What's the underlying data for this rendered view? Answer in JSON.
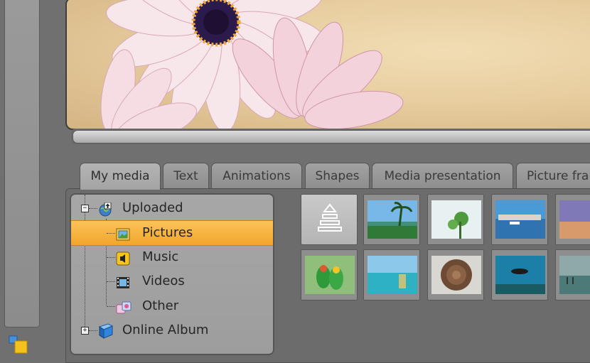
{
  "tabs": [
    {
      "label": "My media",
      "active": true
    },
    {
      "label": "Text",
      "active": false
    },
    {
      "label": "Animations",
      "active": false
    },
    {
      "label": "Shapes",
      "active": false
    },
    {
      "label": "Media presentation",
      "active": false
    },
    {
      "label": "Picture fra",
      "active": false
    }
  ],
  "tree": {
    "uploaded": {
      "label": "Uploaded",
      "expander": "−",
      "icon": "upload-globe-icon"
    },
    "pictures": {
      "label": "Pictures",
      "icon": "pictures-icon",
      "selected": true
    },
    "music": {
      "label": "Music",
      "icon": "music-icon"
    },
    "videos": {
      "label": "Videos",
      "icon": "film-icon"
    },
    "other": {
      "label": "Other",
      "icon": "other-media-icon"
    },
    "online_album": {
      "label": "Online Album",
      "expander": "+",
      "icon": "book-icon"
    }
  },
  "thumbnails": [
    {
      "kind": "upload",
      "icon": "upload-arrow-icon"
    },
    {
      "subject": "palm trees and water"
    },
    {
      "subject": "green plant close-up"
    },
    {
      "subject": "harbor with boats"
    },
    {
      "subject": "beach at dusk"
    },
    {
      "subject": "parrots"
    },
    {
      "subject": "tropical sea with glass"
    },
    {
      "subject": "spiral shell"
    },
    {
      "subject": "scuba diver"
    },
    {
      "subject": "pier at sea"
    }
  ],
  "colors": {
    "selection": "#f7b441",
    "panel": "#a3a3a3",
    "background": "#707070"
  }
}
